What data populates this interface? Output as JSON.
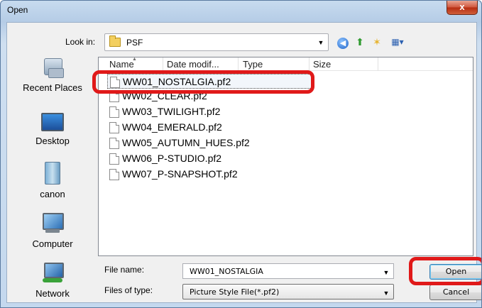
{
  "window": {
    "title": "Open",
    "close_glyph": "x"
  },
  "look_in": {
    "label": "Look in:",
    "value": "PSF",
    "folder_icon": "folder-icon"
  },
  "toolbar": {
    "back_icon": "back-icon",
    "up_icon": "up-folder-icon",
    "new_folder_icon": "new-folder-icon",
    "views_icon": "views-menu-icon"
  },
  "places": [
    {
      "label": "Recent Places",
      "icon": "recent-places-icon"
    },
    {
      "label": "Desktop",
      "icon": "desktop-icon"
    },
    {
      "label": "canon",
      "icon": "user-folder-icon"
    },
    {
      "label": "Computer",
      "icon": "computer-icon"
    },
    {
      "label": "Network",
      "icon": "network-icon"
    }
  ],
  "columns": [
    {
      "label": "Name"
    },
    {
      "label": "Date modif..."
    },
    {
      "label": "Type"
    },
    {
      "label": "Size"
    }
  ],
  "files": [
    {
      "name": "WW01_NOSTALGIA.pf2",
      "selected": true
    },
    {
      "name": "WW02_CLEAR.pf2"
    },
    {
      "name": "WW03_TWILIGHT.pf2"
    },
    {
      "name": "WW04_EMERALD.pf2"
    },
    {
      "name": "WW05_AUTUMN_HUES.pf2"
    },
    {
      "name": "WW06_P-STUDIO.pf2"
    },
    {
      "name": "WW07_P-SNAPSHOT.pf2"
    }
  ],
  "file_name": {
    "label": "File name:",
    "value": "WW01_NOSTALGIA"
  },
  "file_type": {
    "label": "Files of type:",
    "value": "Picture Style File(*.pf2)"
  },
  "buttons": {
    "open": "Open",
    "cancel": "Cancel"
  },
  "colors": {
    "highlight": "#e01919",
    "title_bar": "#b5cce6"
  }
}
